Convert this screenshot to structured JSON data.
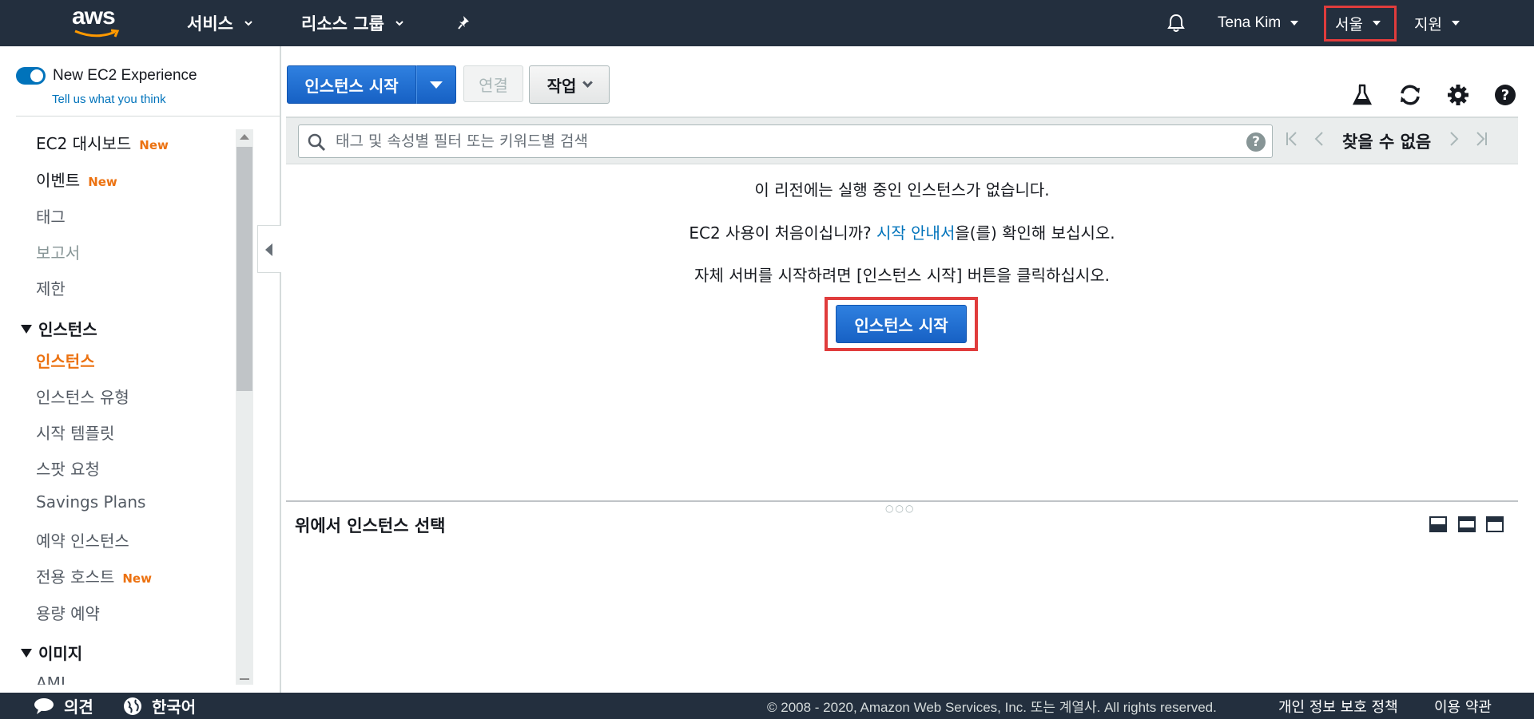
{
  "topnav": {
    "logo_text": "aws",
    "services": "서비스",
    "resource_groups": "리소스 그룹",
    "user": "Tena Kim",
    "region": "서울",
    "support": "지원"
  },
  "sidebar": {
    "toggle_label": "New EC2 Experience",
    "feedback_link": "Tell us what you think",
    "new_tag": "New",
    "items": [
      {
        "label": "EC2 대시보드",
        "new": true
      },
      {
        "label": "이벤트",
        "new": true
      },
      {
        "label": "태그"
      },
      {
        "label": "보고서"
      },
      {
        "label": "제한"
      }
    ],
    "section_instances": "인스턴스",
    "instances_items": [
      {
        "label": "인스턴스"
      },
      {
        "label": "인스턴스 유형"
      },
      {
        "label": "시작 템플릿"
      },
      {
        "label": "스팟 요청"
      },
      {
        "label": "Savings Plans"
      },
      {
        "label": "예약 인스턴스"
      },
      {
        "label": "전용 호스트",
        "new": true
      },
      {
        "label": "용량 예약"
      }
    ],
    "section_images": "이미지",
    "images_items": [
      {
        "label": "AMI"
      }
    ]
  },
  "toolbar": {
    "launch_label": "인스턴스 시작",
    "connect_label": "연결",
    "actions_label": "작업"
  },
  "search": {
    "placeholder": "태그 및 속성별 필터 또는 키워드별 검색",
    "help": "?"
  },
  "pager": {
    "text": "찾을 수 없음"
  },
  "empty_state": {
    "line1": "이 리전에는 실행 중인 인스턴스가 없습니다.",
    "line2_prefix": "EC2 사용이 처음이십니까?",
    "line2_link": "시작 안내서",
    "line2_suffix": "을(를) 확인해 보십시오.",
    "line3": "자체 서버를 시작하려면 [인스턴스 시작] 버튼을 클릭하십시오.",
    "button_label": "인스턴스 시작"
  },
  "bottom_panel": {
    "title": "위에서 인스턴스 선택"
  },
  "footer": {
    "feedback": "의견",
    "language": "한국어",
    "copyright": "© 2008 - 2020, Amazon Web Services, Inc. 또는 계열사. All rights reserved.",
    "privacy": "개인 정보 보호 정책",
    "terms": "이용 약관"
  },
  "colors": {
    "nav_bg": "#232f3e",
    "accent_blue": "#1f6fd1",
    "link_blue": "#0073bb",
    "active_orange": "#ec7211",
    "highlight_red": "#e03c3c"
  }
}
